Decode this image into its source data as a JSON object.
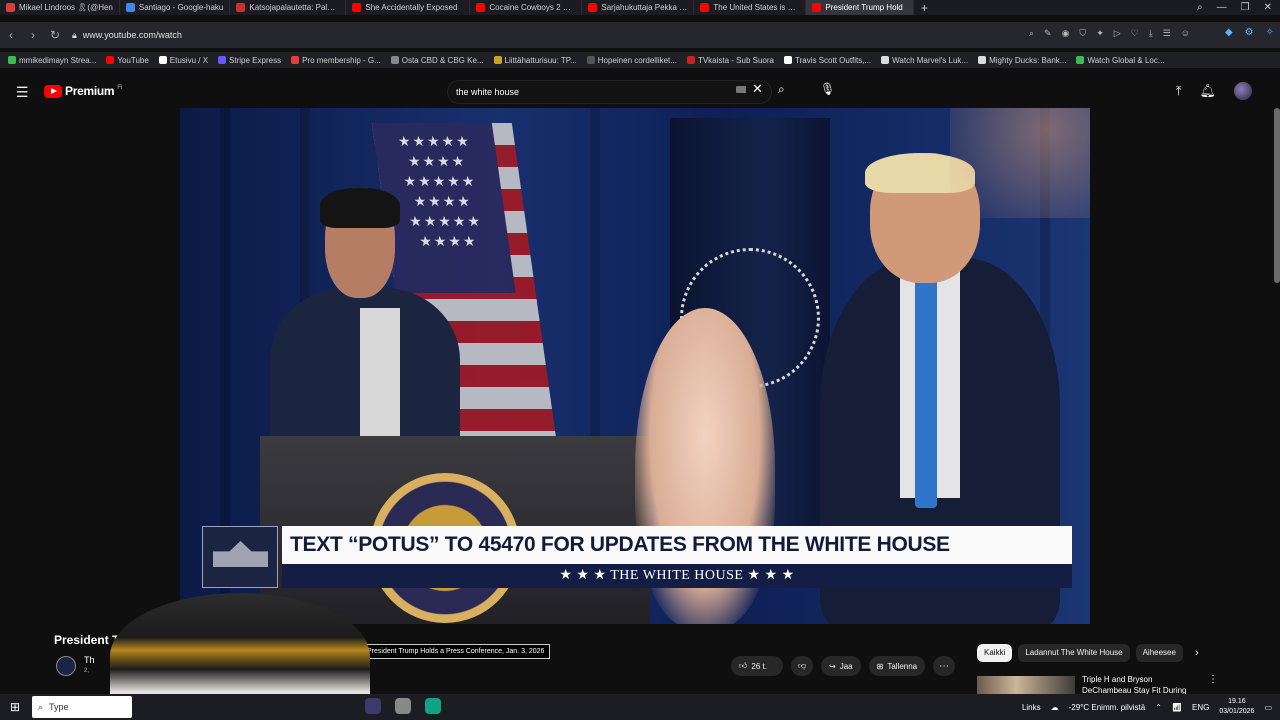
{
  "browser": {
    "tabs": [
      {
        "label": "Mikael Lindroos 🎗(@Hen",
        "color": "#e03a3a"
      },
      {
        "label": "Santiago - Google-haku",
        "color": "#4285f4"
      },
      {
        "label": "Katsojapalautetta: Palande",
        "color": "#d12d2d"
      },
      {
        "label": "She Accidentally Exposed",
        "color": "#ff0000"
      },
      {
        "label": "Cocaine Cowboys 2 Hustl",
        "color": "#ff0000"
      },
      {
        "label": "Sarjahukuttaja Pekka Sepp",
        "color": "#ff0000"
      },
      {
        "label": "The United States is at Wa",
        "color": "#ff0000"
      },
      {
        "label": "President Trump Hold",
        "color": "#ff0000",
        "active": true
      }
    ],
    "new_tab": "+",
    "url": "www.youtube.com/watch",
    "bookmarks": [
      {
        "label": "mmikedimayn Strea...",
        "color": "#3cba54"
      },
      {
        "label": "YouTube",
        "color": "#ff0000"
      },
      {
        "label": "Etusivu / X",
        "color": "#ffffff"
      },
      {
        "label": "Stripe Express",
        "color": "#635bff"
      },
      {
        "label": "Pro membership - G...",
        "color": "#e04040"
      },
      {
        "label": "Osta CBD & CBG Ke...",
        "color": "#888888"
      },
      {
        "label": "Liittähatturisuu: TP...",
        "color": "#c9a227"
      },
      {
        "label": "Hopeinen cordelliket...",
        "color": "#555555"
      },
      {
        "label": "TVkaista - Sub Suora",
        "color": "#cc2222"
      },
      {
        "label": "Travis Scott Outfits,...",
        "color": "#ffffff"
      },
      {
        "label": "Watch Marvel's Luk...",
        "color": "#dddddd"
      },
      {
        "label": "Mighty Ducks: Bank...",
        "color": "#dddddd"
      },
      {
        "label": "Watch Global & Loc...",
        "color": "#3cba54"
      }
    ]
  },
  "youtube": {
    "logo_text": "Premium",
    "logo_badge": "FI",
    "search_value": "the white house",
    "video": {
      "banner_main": "TEXT “POTUS” TO 45470 FOR UPDATES FROM THE WHITE HOUSE",
      "banner_sub": "★ ★ ★   THE WHITE HOUSE   ★ ★ ★"
    },
    "title_visible": "President T",
    "channel_visible": "Th",
    "subs_visible": "2,",
    "tooltip": "President Trump Holds a Press Conference, Jan. 3, 2026",
    "likes": "26 t.",
    "share_label": "Jaa",
    "save_label": "Tallenna",
    "chips": [
      "Kaikki",
      "Ladannut The White House",
      "Aiheesee"
    ],
    "recommendation_title": "Triple H and Bryson DeChambeau Stay Fit During"
  },
  "taskbar": {
    "search_placeholder": "Type",
    "links_label": "Links",
    "weather": "-29°C  Enimm. pilvistä",
    "lang": "ENG",
    "time": "19.16",
    "date": "03/01/2026"
  }
}
